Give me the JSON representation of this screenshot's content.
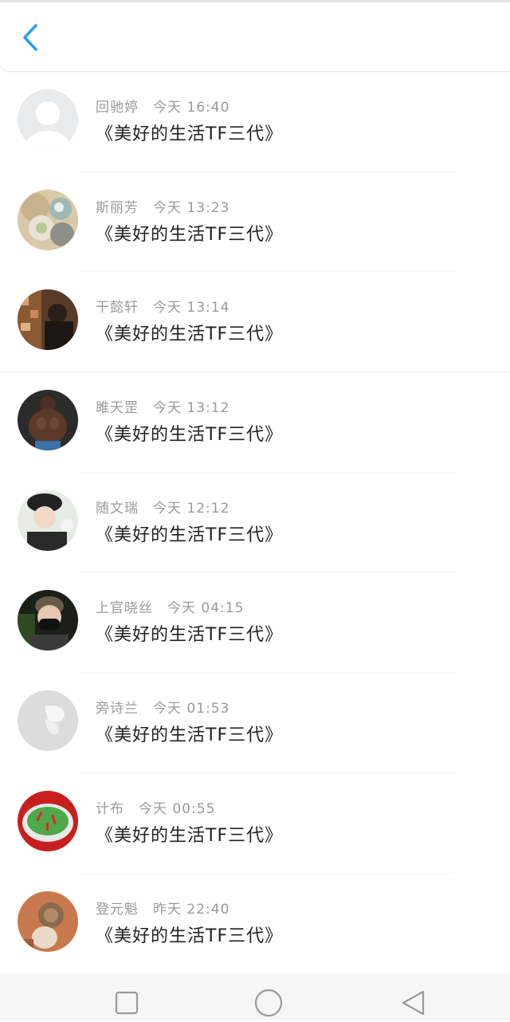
{
  "header": {
    "back_icon": "chevron-left-icon",
    "accent": "#2a9df4"
  },
  "messages": [
    {
      "name": "回驰婷",
      "time": "今天 16:40",
      "text": "《美好的生活TF三代》",
      "avatar": "default-user-avatar"
    },
    {
      "name": "斯丽芳",
      "time": "今天 13:23",
      "text": "《美好的生活TF三代》",
      "avatar": "flower-avatar"
    },
    {
      "name": "干懿轩",
      "time": "今天 13:14",
      "text": "《美好的生活TF三代》",
      "avatar": "room-avatar"
    },
    {
      "name": "雎天罡",
      "time": "今天 13:12",
      "text": "《美好的生活TF三代》",
      "avatar": "bodybuilder-avatar"
    },
    {
      "name": "随文瑞",
      "time": "今天 12:12",
      "text": "《美好的生活TF三代》",
      "avatar": "person-cap-avatar"
    },
    {
      "name": "上官晓丝",
      "time": "今天 04:15",
      "text": "《美好的生活TF三代》",
      "avatar": "masked-person-avatar"
    },
    {
      "name": "旁诗兰",
      "time": "今天 01:53",
      "text": "《美好的生活TF三代》",
      "avatar": "white-butterfly-avatar"
    },
    {
      "name": "计布",
      "time": "今天 00:55",
      "text": "《美好的生活TF三代》",
      "avatar": "food-plate-avatar"
    },
    {
      "name": "登元魁",
      "time": "昨天 22:40",
      "text": "《美好的生活TF三代》",
      "avatar": "cat-avatar"
    }
  ],
  "navbar": {
    "square_icon": "recent-apps-icon",
    "circle_icon": "home-icon",
    "triangle_icon": "back-triangle-icon"
  }
}
